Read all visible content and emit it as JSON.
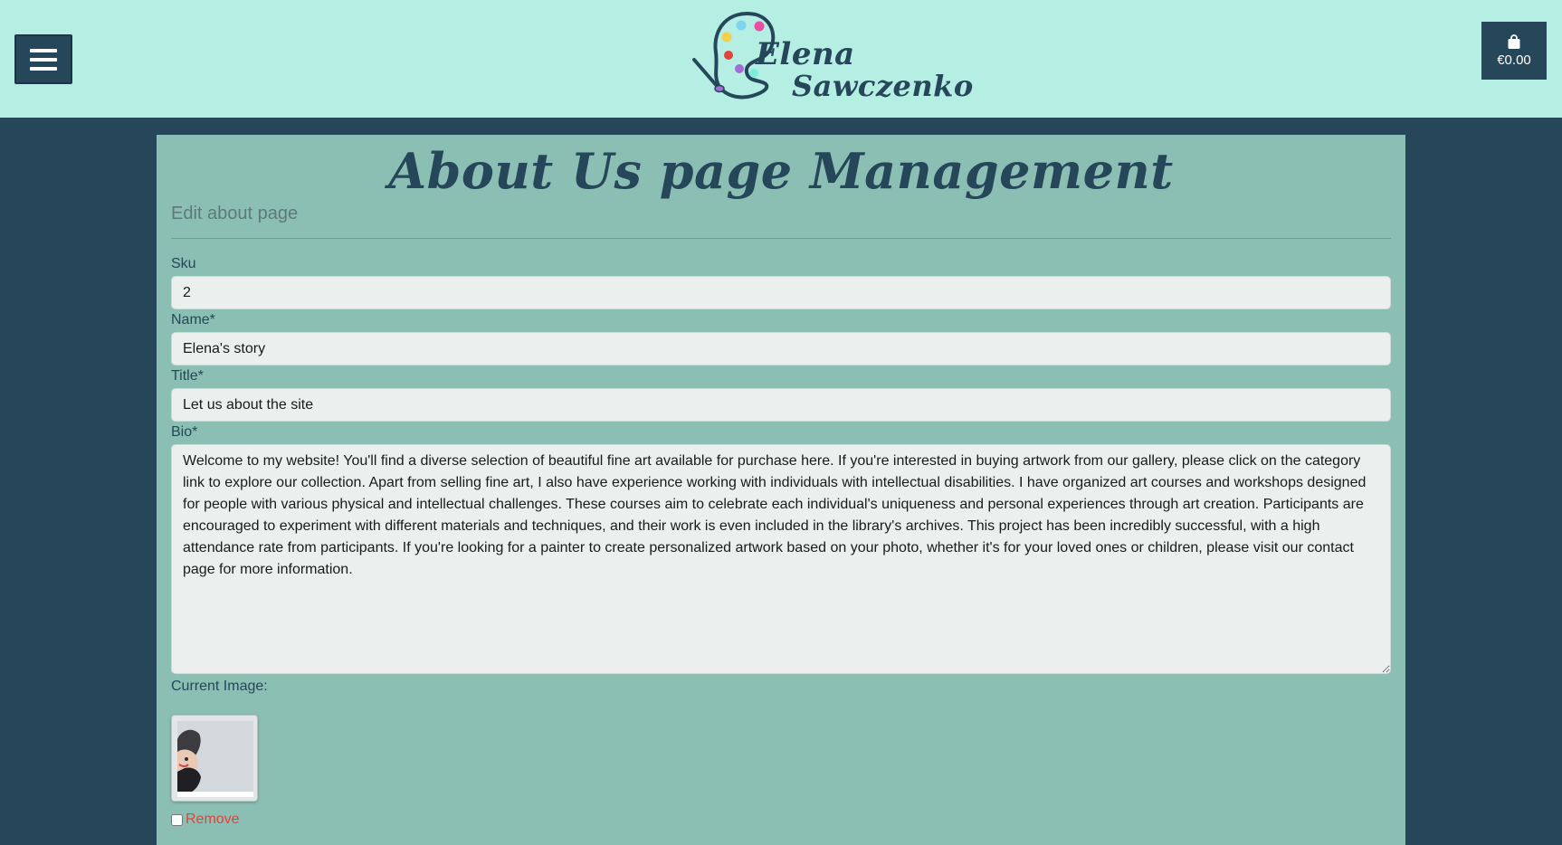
{
  "header": {
    "menu_icon": "hamburger-icon",
    "logo": {
      "first_name": "Elena",
      "last_name": "Sawczenko",
      "icon": "paint-palette-icon"
    },
    "cart": {
      "icon": "shopping-bag-icon",
      "total": "€0.00"
    }
  },
  "main": {
    "title": "About Us page Management",
    "subtitle": "Edit about page",
    "form": {
      "sku": {
        "label": "Sku",
        "value": "2"
      },
      "name": {
        "label": "Name*",
        "value": "Elena's story"
      },
      "title": {
        "label": "Title*",
        "value": "Let us about the site"
      },
      "bio": {
        "label": "Bio*",
        "value": "Welcome to my website! You'll find a diverse selection of beautiful fine art available for purchase here. If you're interested in buying artwork from our gallery, please click on the category link to explore our collection. Apart from selling fine art, I also have experience working with individuals with intellectual disabilities. I have organized art courses and workshops designed for people with various physical and intellectual challenges. These courses aim to celebrate each individual's uniqueness and personal experiences through art creation. Participants are encouraged to experiment with different materials and techniques, and their work is even included in the library's archives. This project has been incredibly successful, with a high attendance rate from participants. If you're looking for a painter to create personalized artwork based on your photo, whether it's for your loved ones or children, please visit our contact page for more information."
      },
      "image": {
        "label": "Current Image:",
        "remove_label": "Remove",
        "remove_checked": false
      }
    }
  },
  "colors": {
    "header_bg": "#b5eee3",
    "page_bg": "#26465a",
    "panel_bg": "#8cbfb3",
    "accent_dark": "#26465a",
    "remove_red": "#e0443a"
  }
}
